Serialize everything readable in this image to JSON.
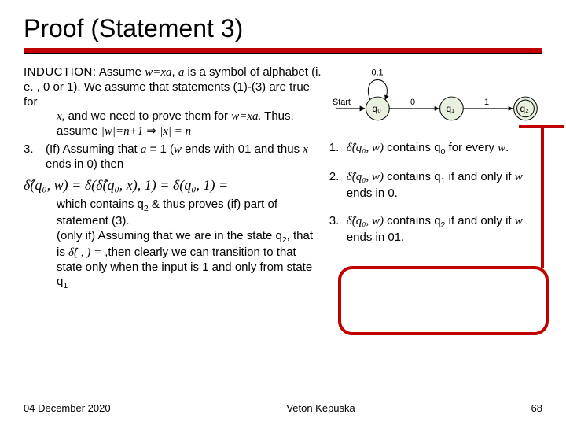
{
  "title": "Proof (Statement 3)",
  "induction": {
    "label": "INDUCTION:",
    "text1": " Assume ",
    "wxa": "w=xa",
    "text2": ", ",
    "a": "a",
    "text3": " is a symbol of alphabet (i. e. ,  0 or 1). We assume that statements (1)-(3) are true for ",
    "x": "x,",
    "text4": " and we need to prove them for ",
    "wxa2": "w=xa.",
    "text5": "  Thus, assume ",
    "abs1": "|w|=n+1",
    "imp": " ⇒ ",
    "abs2": "|x| = n"
  },
  "item3": {
    "num": "3.",
    "if_part": "(If) Assuming that ",
    "a1": "a",
    "eq1": " = 1 (",
    "w": "w",
    "ends01": " ends with 01 and thus ",
    "x2": "x",
    "ends0": " ends in 0) then",
    "eq_line": "δ̂(q₀, w) = δ(δ̂(q₀, x), 1) =  δ(q₀, 1) =",
    "after1": "which contains q",
    "sub2": "2",
    "after2": " & thus proves (if) part of statement (3).",
    "onlyif1": "(only if) Assuming that we are in the state q",
    "onlyif_sub": "2",
    "onlyif2": ", that is ",
    "dhat": "δ̂(   ,  ) =",
    "onlyif3": " ,then clearly we can transition to that state only when the input is 1 and only from state q",
    "onlyif_sub1": "1"
  },
  "right": {
    "item1": {
      "n": "1.",
      "dh": "δ̂(q₀, w)",
      "t1": " contains q",
      "s": "0",
      "t2": " for every ",
      "w": "w",
      "t3": "."
    },
    "item2": {
      "n": "2.",
      "dh": "δ̂(q₀, w)",
      "t1": " contains q",
      "s": "1",
      "t2": " if and only if ",
      "w": "w",
      "t3": " ends in 0."
    },
    "item3": {
      "n": "3.",
      "dh": "δ̂(q₀, w)",
      "t1": " contains q",
      "s": "2",
      "t2": " if and only if ",
      "w": "w",
      "t3": " ends in 01."
    }
  },
  "diagram": {
    "start": "Start",
    "q0": "q₀",
    "q1": "q₁",
    "q2": "q₂",
    "e01": "0,1",
    "e0": "0",
    "e1": "1"
  },
  "footer": {
    "date": "04 December 2020",
    "author": "Veton Këpuska",
    "page": "68"
  }
}
